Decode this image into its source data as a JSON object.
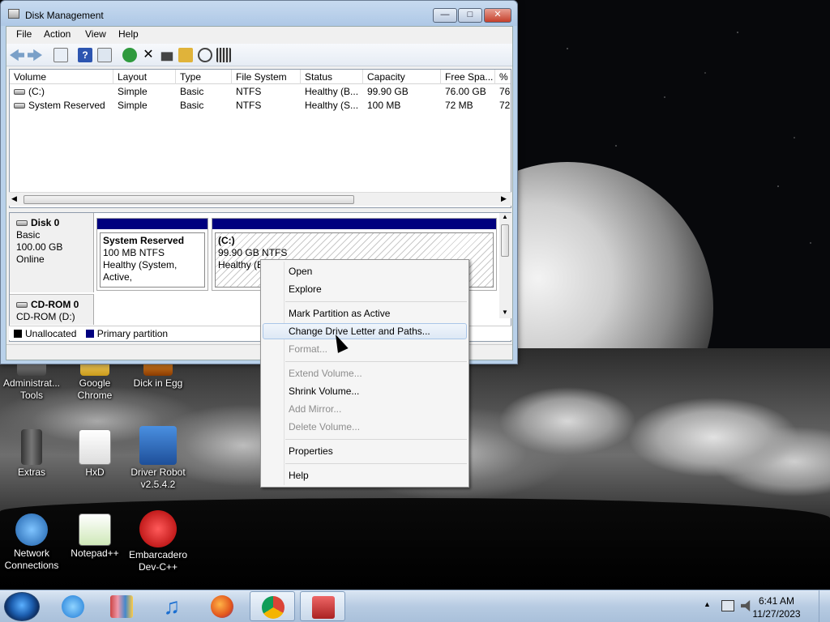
{
  "window": {
    "title": "Disk Management",
    "min_glyph": "—",
    "max_glyph": "□",
    "close_glyph": "✕"
  },
  "menubar": [
    "File",
    "Action",
    "View",
    "Help"
  ],
  "volume_list": {
    "columns": [
      "Volume",
      "Layout",
      "Type",
      "File System",
      "Status",
      "Capacity",
      "Free Spa...",
      "% F"
    ],
    "rows": [
      {
        "volume": "(C:)",
        "layout": "Simple",
        "type": "Basic",
        "fs": "NTFS",
        "status": "Healthy (B...",
        "capacity": "99.90 GB",
        "free": "76.00 GB",
        "pct": "76"
      },
      {
        "volume": "System Reserved",
        "layout": "Simple",
        "type": "Basic",
        "fs": "NTFS",
        "status": "Healthy (S...",
        "capacity": "100 MB",
        "free": "72 MB",
        "pct": "72"
      }
    ]
  },
  "disks": {
    "disk0": {
      "name": "Disk 0",
      "type": "Basic",
      "size": "100.00 GB",
      "state": "Online"
    },
    "cdrom0": {
      "name": "CD-ROM 0",
      "drive": "CD-ROM (D:)"
    },
    "partitions": [
      {
        "name": "System Reserved",
        "size": "100 MB NTFS",
        "status": "Healthy (System, Active,"
      },
      {
        "name": "(C:)",
        "size": "99.90 GB NTFS",
        "status": "Healthy (Bo"
      }
    ]
  },
  "legend": {
    "unallocated": "Unallocated",
    "primary": "Primary partition"
  },
  "context_menu": {
    "open": "Open",
    "explore": "Explore",
    "mark_active": "Mark Partition as Active",
    "change_letter": "Change Drive Letter and Paths...",
    "format": "Format...",
    "extend": "Extend Volume...",
    "shrink": "Shrink Volume...",
    "add_mirror": "Add Mirror...",
    "delete": "Delete Volume...",
    "properties": "Properties",
    "help": "Help"
  },
  "desktop_icons": {
    "admin_tools": "Administrat... Tools",
    "chrome": "Google Chrome",
    "dick_in_egg": "Dick in Egg",
    "extras": "Extras",
    "hxd": "HxD",
    "driver_robot": "Driver Robot v2.5.4.2",
    "network": "Network Connections",
    "notepadpp": "Notepad++",
    "devcpp": "Embarcadero Dev-C++"
  },
  "taskbar": {
    "time": "6:41 AM",
    "date": "11/27/2023",
    "tray_arrow": "▲"
  },
  "colors": {
    "primary_partition": "#00007f",
    "unallocated": "#000000"
  }
}
